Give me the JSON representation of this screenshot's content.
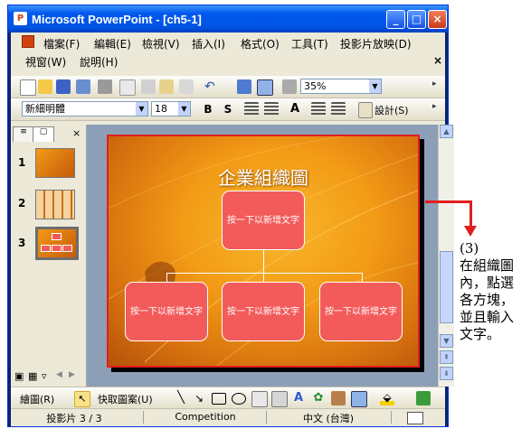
{
  "window": {
    "title": "Microsoft PowerPoint - [ch5-1]",
    "app_icon": "P"
  },
  "menubar": {
    "row1": [
      "檔案(F)",
      "編輯(E)",
      "檢視(V)",
      "插入(I)",
      "格式(O)",
      "工具(T)",
      "投影片放映(D)"
    ],
    "row2": [
      "視窗(W)",
      "說明(H)"
    ],
    "close_symbol": "×"
  },
  "standard_toolbar": {
    "zoom": "35%"
  },
  "format_toolbar": {
    "font": "新細明體",
    "size": "18",
    "bold": "B",
    "shadow": "S",
    "design_label": "設計(S)"
  },
  "slides": [
    {
      "num": "1"
    },
    {
      "num": "2"
    },
    {
      "num": "3"
    }
  ],
  "slide": {
    "title": "企業組織圖",
    "top_box": "按一下以新增文字",
    "bottom_boxes": [
      "按一下以新增文字",
      "按一下以新增文字",
      "按一下以新增文字"
    ]
  },
  "drawbar": {
    "draw_label": "繪圖(R)",
    "autoshape_label": "快取圖案(U)"
  },
  "status": {
    "slide": "投影片 3 / 3",
    "design": "Competition",
    "lang": "中文 (台灣)"
  },
  "annotation": {
    "step": "(3)",
    "lines": [
      "在組織圖",
      "內，點選",
      "各方塊，",
      "並且輸入",
      "文字。"
    ]
  },
  "colors": {
    "title_bar": "#0054e3",
    "box_fill": "#f35b5b",
    "highlight": "#e01e1e",
    "slide_bg": "#f39b16"
  }
}
